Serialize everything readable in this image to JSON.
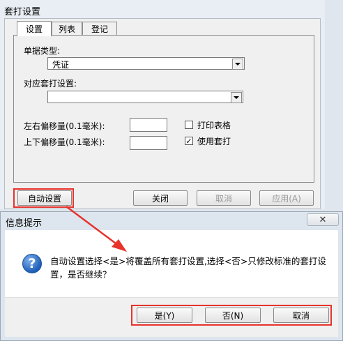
{
  "main_window": {
    "title": "套打设置",
    "tabs": [
      {
        "label": "设置",
        "active": true
      },
      {
        "label": "列表",
        "active": false
      },
      {
        "label": "登记",
        "active": false
      }
    ],
    "doc_type_label": "单据类型:",
    "doc_type_value": "凭证",
    "print_setting_label": "对应套打设置:",
    "print_setting_value": "",
    "lr_offset_label": "左右偏移量(0.1毫米):",
    "ud_offset_label": "上下偏移量(0.1毫米):",
    "lr_offset_value": "",
    "ud_offset_value": "",
    "print_table_label": "打印表格",
    "print_table_checked": "",
    "use_print_label": "使用套打",
    "use_print_checked": "✓",
    "buttons": {
      "auto": "自动设置",
      "close": "关闭",
      "cancel": "取消",
      "apply": "应用(A)"
    }
  },
  "dialog": {
    "title": "信息提示",
    "close_glyph": "✕",
    "icon_glyph": "?",
    "message": "自动设置选择<是>将覆盖所有套打设置,选择<否>只修改标准的套打设置，是否继续？",
    "buttons": {
      "yes": "是(Y)",
      "no": "否(N)",
      "cancel": "取消"
    }
  },
  "colors": {
    "annotation_red": "#e8332c"
  }
}
